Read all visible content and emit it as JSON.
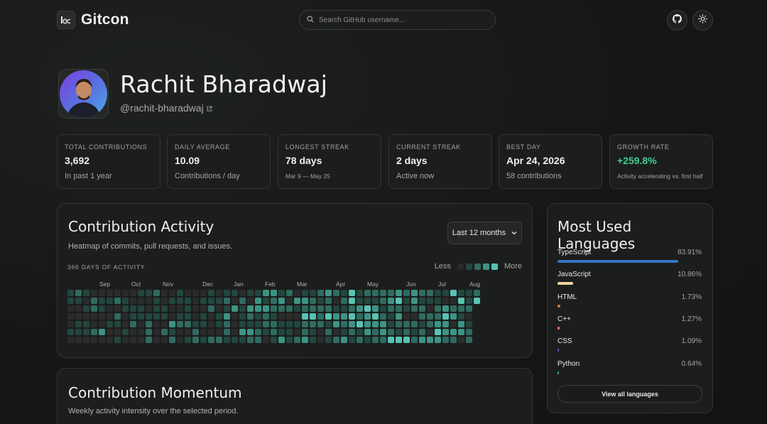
{
  "app": {
    "brand": "Gitcon"
  },
  "search": {
    "placeholder": "Search GitHub username..."
  },
  "profile": {
    "name": "Rachit Bharadwaj",
    "handle": "@rachit-bharadwaj"
  },
  "stats": [
    {
      "label": "Total Contributions",
      "value": "3,692",
      "sub": "In past 1 year"
    },
    {
      "label": "Daily Average",
      "value": "10.09",
      "sub": "Contributions / day"
    },
    {
      "label": "Longest Streak",
      "value": "78 days",
      "sub": "Mar 9 — May 25"
    },
    {
      "label": "Current Streak",
      "value": "2 days",
      "sub": "Active now"
    },
    {
      "label": "Best Day",
      "value": "Apr 24, 2026",
      "sub": "58 contributions"
    },
    {
      "label": "Growth Rate",
      "value": "+259.8%",
      "sub": "Activity accelerating vs. first half"
    }
  ],
  "activity": {
    "title": "Contribution Activity",
    "subtitle": "Heatmap of commits, pull requests, and issues.",
    "range": "Last 12 months",
    "days_label": "366 DAYS OF ACTIVITY",
    "legend_less": "Less",
    "legend_more": "More",
    "months": [
      "Sep",
      "Oct",
      "Nov",
      "Dec",
      "Jan",
      "Feb",
      "Mar",
      "Apr",
      "May",
      "Jun",
      "Jul",
      "Aug"
    ],
    "colors": [
      "#2a2c2b",
      "#23463f",
      "#2f6b60",
      "#3d9385",
      "#57c3b3"
    ]
  },
  "momentum": {
    "title": "Contribution Momentum",
    "subtitle": "Weekly activity intensity over the selected period."
  },
  "languages": {
    "title": "Most Used Languages",
    "items": [
      {
        "name": "TypeScript",
        "pct": "83.91%",
        "value": 83.91,
        "color": "#3574c9"
      },
      {
        "name": "JavaScript",
        "pct": "10.86%",
        "value": 10.86,
        "color": "#f0d49a"
      },
      {
        "name": "HTML",
        "pct": "1.73%",
        "value": 1.73,
        "color": "#e07a4e"
      },
      {
        "name": "C++",
        "pct": "1.27%",
        "value": 1.27,
        "color": "#e6805f"
      },
      {
        "name": "CSS",
        "pct": "1.09%",
        "value": 1.09,
        "color": "#6b55c8"
      },
      {
        "name": "Python",
        "pct": "0.64%",
        "value": 0.64,
        "color": "#3ba88f"
      }
    ],
    "view_all": "View all languages"
  },
  "icons": {
    "github": "github-icon",
    "theme": "sun-icon",
    "search": "search-icon",
    "external": "external-link-icon"
  }
}
